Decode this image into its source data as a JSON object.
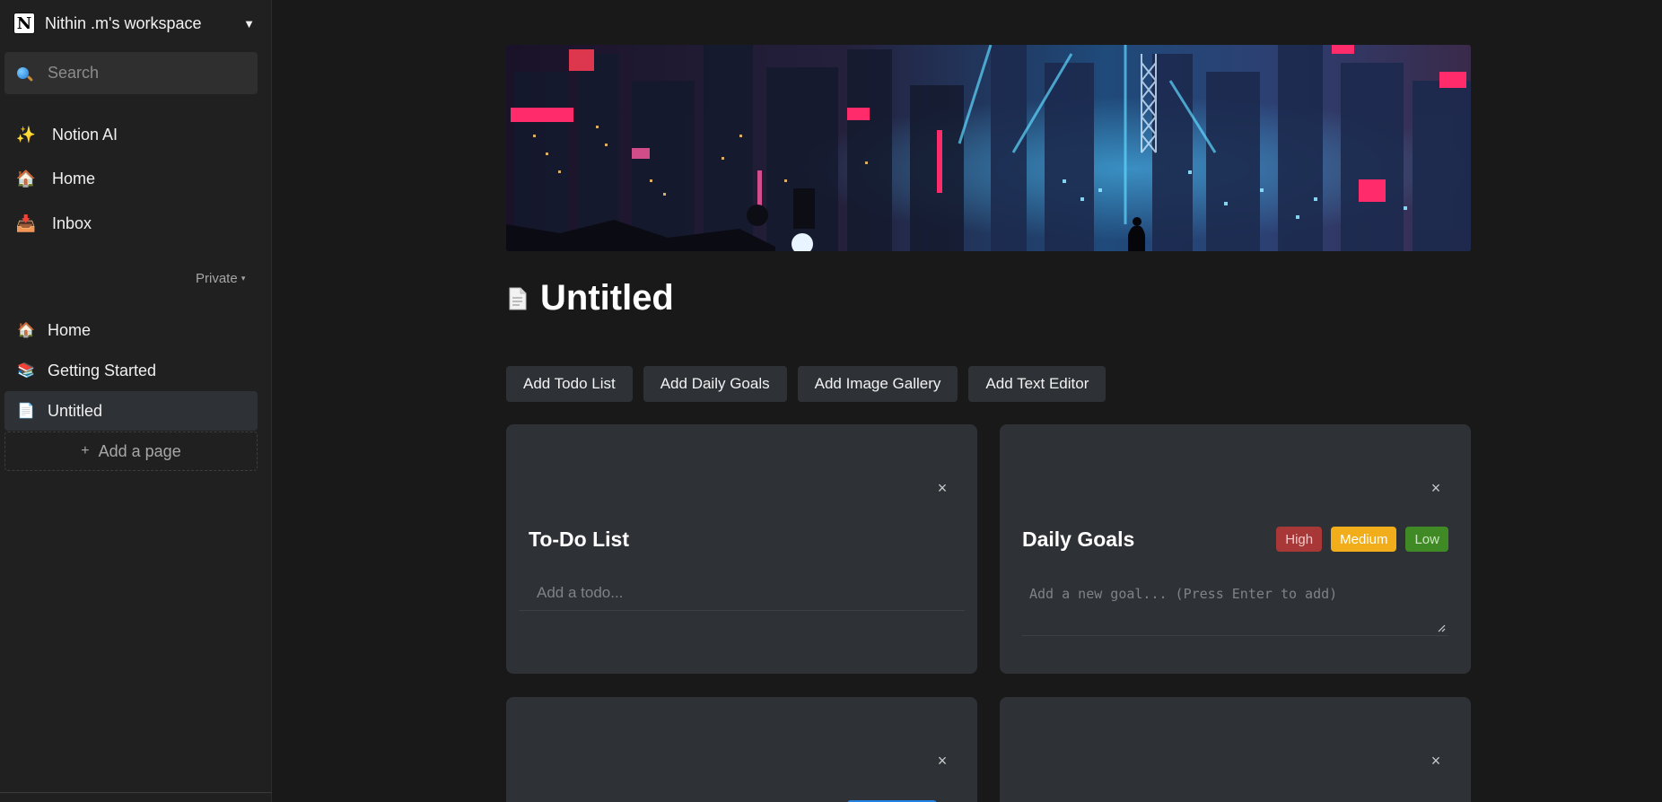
{
  "sidebar": {
    "workspace": {
      "logo": "N",
      "name": "Nithin .m's workspace",
      "caret": "▼"
    },
    "search": {
      "placeholder": "Search"
    },
    "top_items": [
      {
        "icon": "sparkles-icon",
        "emoji": "✨",
        "label": "Notion AI"
      },
      {
        "icon": "house-icon",
        "emoji": "🏠",
        "label": "Home"
      },
      {
        "icon": "inbox-icon",
        "emoji": "📥",
        "label": "Inbox"
      }
    ],
    "section_label": "Private",
    "section_caret": "▾",
    "pages": [
      {
        "icon": "house-icon",
        "emoji": "🏠",
        "label": "Home"
      },
      {
        "icon": "books-icon",
        "emoji": "📚",
        "label": "Getting Started"
      },
      {
        "icon": "page-icon",
        "emoji": "📄",
        "label": "Untitled",
        "active": true
      }
    ],
    "add_page": {
      "plus": "+",
      "label": "Add a page"
    }
  },
  "main": {
    "page_icon": "page-icon",
    "title": "Untitled",
    "toolbar": [
      "Add Todo List",
      "Add Daily Goals",
      "Add Image Gallery",
      "Add Text Editor"
    ],
    "cards": {
      "todo": {
        "title": "To-Do List",
        "input_placeholder": "Add a todo...",
        "close": "×"
      },
      "goals": {
        "title": "Daily Goals",
        "badges": {
          "high": "High",
          "medium": "Medium",
          "low": "Low"
        },
        "textarea_placeholder": "Add a new goal... (Press Enter to add)",
        "close": "×"
      },
      "third": {
        "close": "×"
      },
      "fourth": {
        "close": "×"
      }
    }
  },
  "colors": {
    "background": "#191919",
    "sidebar": "#202020",
    "card": "#2e3236",
    "high": "#a83838",
    "medium": "#f2ae1a",
    "low": "#3f8a25",
    "accent_blue": "#2383e2"
  }
}
